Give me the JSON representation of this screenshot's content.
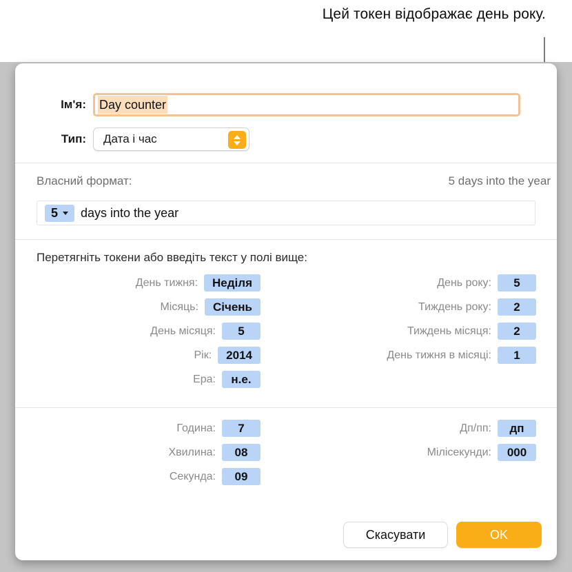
{
  "callout": {
    "text": "Цей токен відображає день року."
  },
  "dialog": {
    "name_row": {
      "label": "Ім'я:",
      "value": "Day counter"
    },
    "type_row": {
      "label": "Тип:",
      "value": "Дата і час"
    },
    "format_section": {
      "label": "Власний формат:",
      "preview": "5 days into the year",
      "token_value": "5",
      "tail_text": "days into the year"
    },
    "instruction": "Перетягніть токени або введіть текст у полі вище:",
    "date_tokens_left": [
      {
        "label": "День тижня:",
        "value": "Неділя"
      },
      {
        "label": "Місяць:",
        "value": "Січень"
      },
      {
        "label": "День місяця:",
        "value": "5"
      },
      {
        "label": "Рік:",
        "value": "2014"
      },
      {
        "label": "Ера:",
        "value": "н.е."
      }
    ],
    "date_tokens_right": [
      {
        "label": "День року:",
        "value": "5"
      },
      {
        "label": "Тиждень року:",
        "value": "2"
      },
      {
        "label": "Тиждень місяця:",
        "value": "2"
      },
      {
        "label": "День тижня в місяці:",
        "value": "1"
      }
    ],
    "time_tokens_left": [
      {
        "label": "Година:",
        "value": "7"
      },
      {
        "label": "Хвилина:",
        "value": "08"
      },
      {
        "label": "Секунда:",
        "value": "09"
      }
    ],
    "time_tokens_right": [
      {
        "label": "Дп/пп:",
        "value": "дп"
      },
      {
        "label": "Мілісекунди:",
        "value": "000"
      }
    ],
    "buttons": {
      "cancel": "Скасувати",
      "ok": "OK"
    }
  },
  "colors": {
    "token_blue": "#b9d4f7",
    "accent_orange": "#f9ad16",
    "focus_ring": "#f3c193",
    "selection": "#fbdcbb"
  }
}
